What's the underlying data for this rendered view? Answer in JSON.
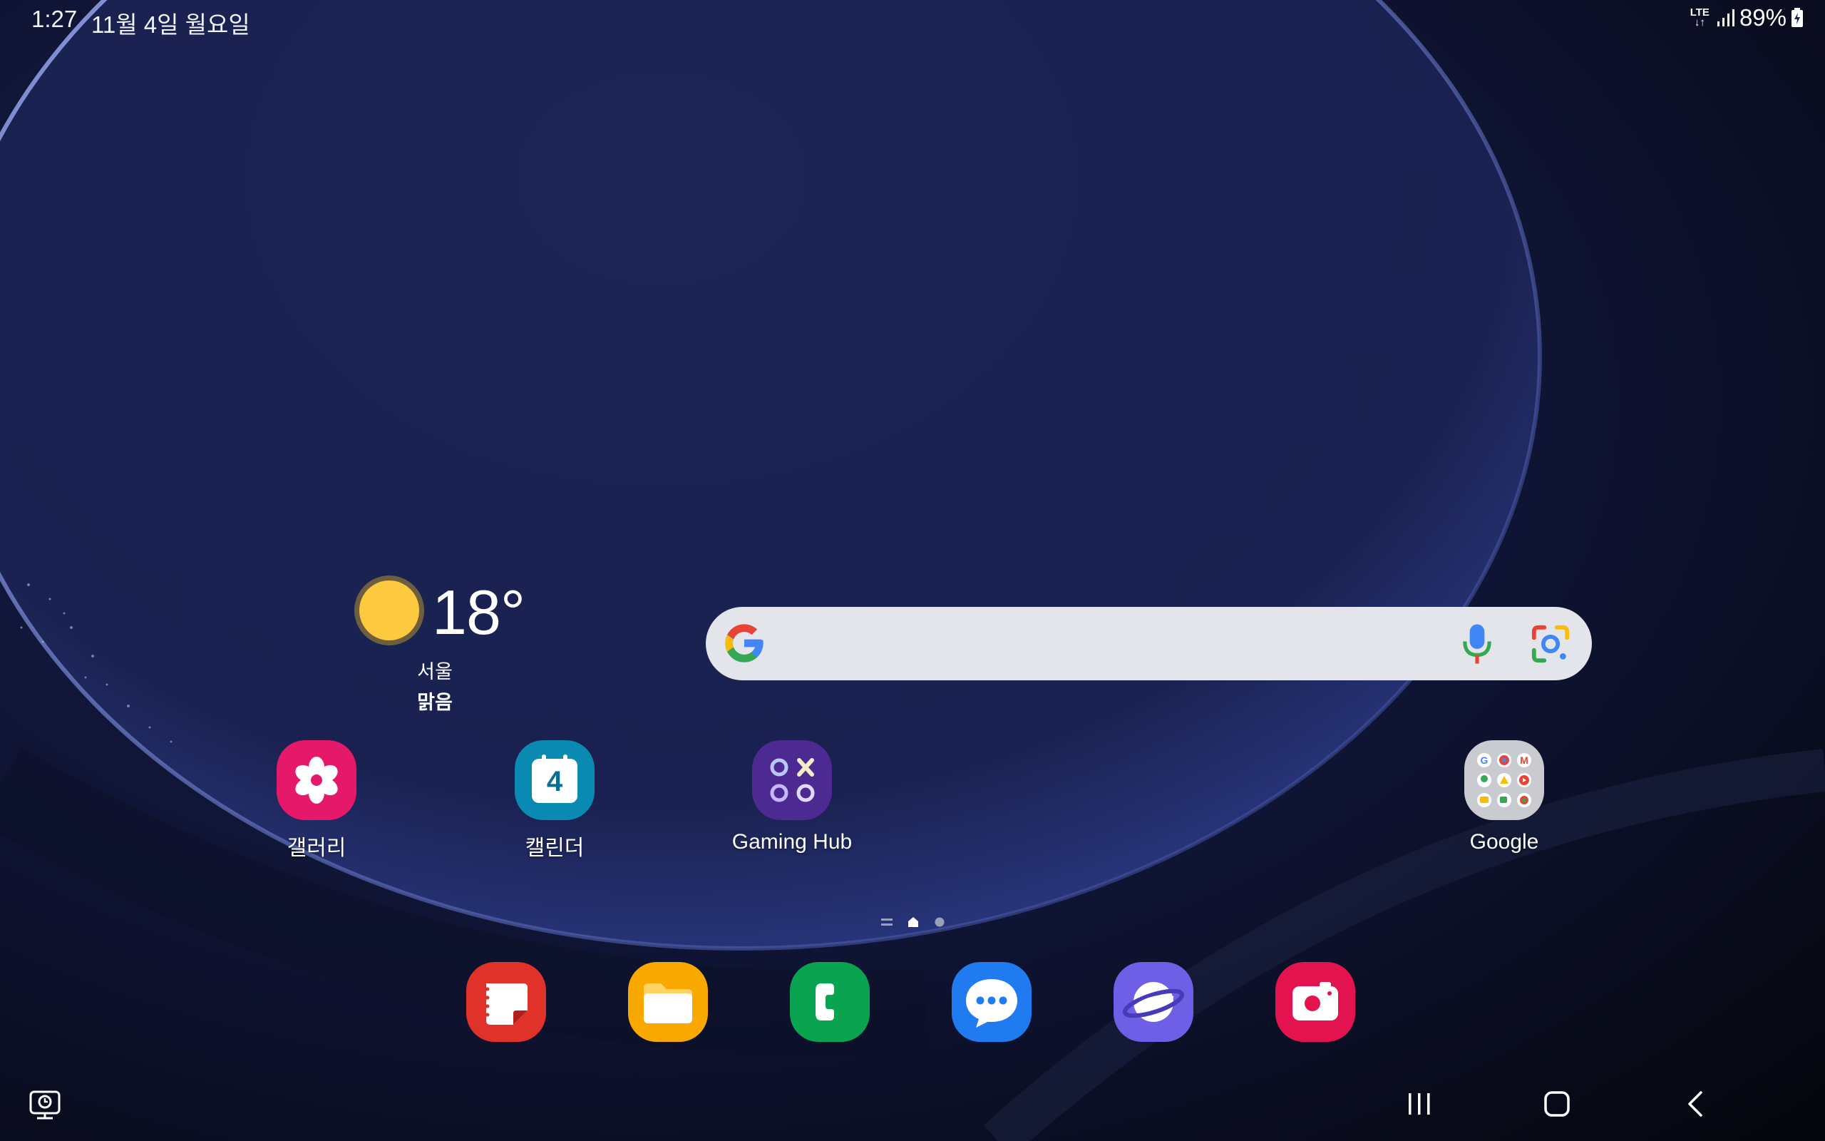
{
  "status_bar": {
    "time": "1:27",
    "date": "11월 4일 월요일",
    "network": "LTE",
    "battery": "89%"
  },
  "weather": {
    "temperature": "18°",
    "city": "서울",
    "condition": "맑음",
    "icon": "sun-icon"
  },
  "search": {
    "icons": [
      "google-g-icon",
      "microphone-icon",
      "google-lens-icon"
    ]
  },
  "apps": [
    {
      "label": "갤러리",
      "icon": "gallery-icon",
      "color": "#e6186a"
    },
    {
      "label": "캘린더",
      "icon": "calendar-icon",
      "color": "#0a8ab3",
      "day": "4"
    },
    {
      "label": "Gaming Hub",
      "icon": "gaming-hub-icon",
      "color": "#4d2a92"
    },
    {
      "label": "Google",
      "icon": "google-folder-icon",
      "color": "#c9cbd1"
    }
  ],
  "dock": [
    {
      "icon": "notes-icon",
      "color": "#e0322a"
    },
    {
      "icon": "my-files-icon",
      "color": "#f9a800"
    },
    {
      "icon": "phone-icon",
      "color": "#0aa34f"
    },
    {
      "icon": "messages-icon",
      "color": "#1f7bef"
    },
    {
      "icon": "internet-icon",
      "color": "#6e5fe6"
    },
    {
      "icon": "camera-icon",
      "color": "#e3134f"
    }
  ],
  "navigation": {
    "icons": [
      "recent-apps-icon",
      "home-icon",
      "back-icon",
      "taskbar-toggle-icon"
    ]
  }
}
